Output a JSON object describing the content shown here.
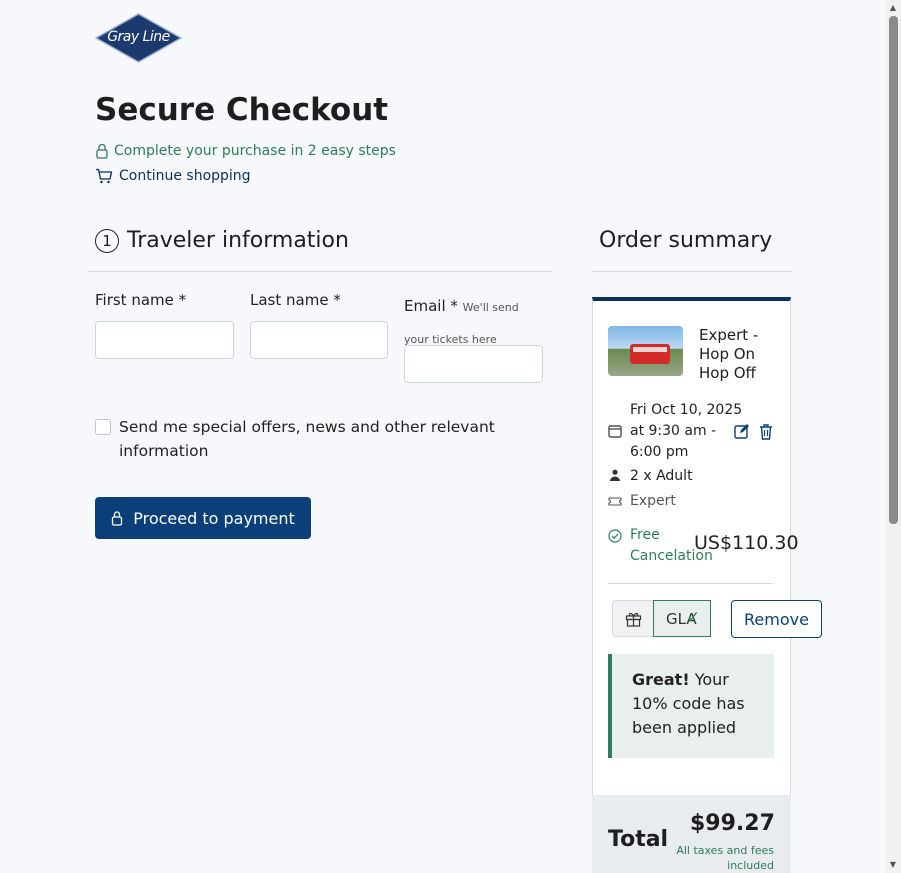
{
  "brand": {
    "logo_text": "Gray Line",
    "color": "#1d3a6e"
  },
  "header": {
    "title": "Secure Checkout",
    "easy_steps": "Complete your purchase in 2 easy steps",
    "continue_shopping": "Continue shopping"
  },
  "traveler": {
    "step_number": "1",
    "title": "Traveler information",
    "first_name_label": "First name *",
    "last_name_label": "Last name *",
    "email_label": "Email *",
    "email_hint": "We'll send your tickets here",
    "first_name_value": "",
    "last_name_value": "",
    "email_value": "",
    "offers_label": "Send me special offers, news and other relevant information",
    "offers_checked": false,
    "proceed_label": "Proceed to payment"
  },
  "summary": {
    "title": "Order summary",
    "product_name": "Expert - Hop On Hop Off",
    "date_line1": "Fri Oct 10, 2025",
    "date_line2": "at 9:30 am -",
    "date_line3": "6:00 pm",
    "travelers": "2 x Adult",
    "ticket_type": "Expert",
    "free_cancel": "Free Cancelation",
    "price": "US$110.30",
    "promo_code": "GLA",
    "remove_label": "Remove",
    "alert_strong": "Great!",
    "alert_text": "Your 10% code has been applied",
    "total_label": "Total",
    "total_amount": "$99.27",
    "taxes_note": "All taxes and fees included"
  },
  "colors": {
    "primary": "#0b3f7a",
    "success": "#2e7d5b",
    "background": "#f6f8fb"
  }
}
